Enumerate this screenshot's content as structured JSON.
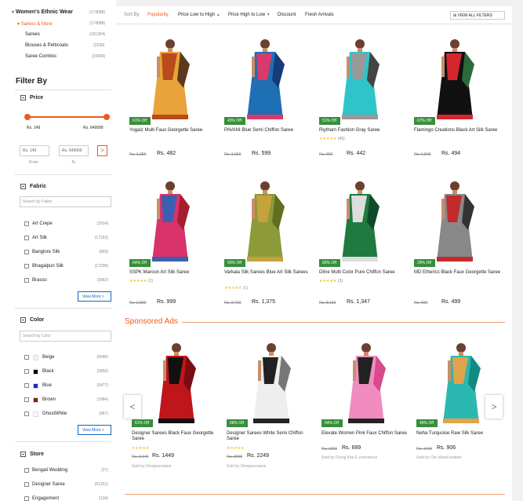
{
  "sidebar": {
    "categories": [
      {
        "label": "Women's Ethnic Wear",
        "count": "(174588)"
      },
      {
        "label": "Sarees & More",
        "count": "(174588)"
      },
      {
        "label": "Sarees",
        "count": "(161304)"
      },
      {
        "label": "Blouses & Petticoats",
        "count": "(3236)"
      },
      {
        "label": "Saree Combos",
        "count": "(10068)"
      }
    ],
    "filter_by": "Filter By",
    "price": {
      "title": "Price",
      "min_label": "Rs. 149",
      "max_label": "Rs. 649999",
      "min_input": "Rs. 149",
      "max_input": "Rs. 649999",
      "from": "From",
      "to": "To",
      "go": ">"
    },
    "fabric": {
      "title": "Fabric",
      "search_placeholder": "Search by Fabric",
      "items": [
        {
          "label": "Art Crepe",
          "count": "(2914)"
        },
        {
          "label": "Art Silk",
          "count": "(17162)"
        },
        {
          "label": "Banglore Silk",
          "count": "(803)"
        },
        {
          "label": "Bhagalpuri Silk",
          "count": "(17209)"
        },
        {
          "label": "Brasso",
          "count": "(3062)"
        }
      ],
      "view_more": "View More >"
    },
    "color": {
      "title": "Color",
      "search_placeholder": "Search by Color",
      "items": [
        {
          "label": "Beige",
          "count": "(6046)",
          "swatch": "#f5f5dc"
        },
        {
          "label": "Black",
          "count": "(5860)",
          "swatch": "#000000"
        },
        {
          "label": "Blue",
          "count": "(6477)",
          "swatch": "#1e24c9"
        },
        {
          "label": "Brown",
          "count": "(1984)",
          "swatch": "#8b1a1a"
        },
        {
          "label": "GhostWhite",
          "count": "(967)",
          "swatch": "#f8f8ff"
        }
      ],
      "view_more": "View More >"
    },
    "store": {
      "title": "Store",
      "items": [
        {
          "label": "Bengali Wedding",
          "count": "(27)"
        },
        {
          "label": "Designer Saree",
          "count": "(61251)"
        },
        {
          "label": "Engagement",
          "count": "(134)"
        }
      ]
    }
  },
  "sortbar": {
    "sort_by": "Sort By",
    "options": [
      "Popularity",
      "Price Low to High",
      "Price High to Low",
      "Discount",
      "Fresh Arrivals"
    ],
    "view_all": "VIEW ALL FILTERS"
  },
  "products": [
    {
      "badge": "61% Off",
      "title": "Yogaiz Multi Faux Georgette Saree",
      "rating": "",
      "mrp": "Rs. 1,250",
      "price": "Rs. 482"
    },
    {
      "badge": "43% Off",
      "title": "PAVANI Blue Semi Chiffon Saree",
      "rating": "",
      "mrp": "Rs. 1,050",
      "price": "Rs. 599"
    },
    {
      "badge": "51% Off",
      "title": "Riytham Fashion Gray Saree",
      "rating": "(45)",
      "mrp": "Rs. 900",
      "price": "Rs. 442"
    },
    {
      "badge": "67% Off",
      "title": "Flamingo Creations Black Art Silk Saree",
      "rating": "",
      "mrp": "Rs. 1,500",
      "price": "Rs. 494"
    },
    {
      "badge": "64% Off",
      "title": "SSPK Maroon Art Silk Saree",
      "rating": "(1)",
      "mrp": "Rs. 2,800",
      "price": "Rs. 999"
    },
    {
      "badge": "50% Off",
      "title": "Varkala Silk Sarees Blue Art Silk Sarees",
      "rating": "(1)",
      "mrp": "Rs. 2,760",
      "price": "Rs. 1,375"
    },
    {
      "badge": "83% Off",
      "title": "Dline Multi Color Pure Chiffon Saree",
      "rating": "(3)",
      "mrp": "Rs. 8,150",
      "price": "Rs. 1,347"
    },
    {
      "badge": "29% Off",
      "title": "MD Etherics Black Faux Georgette Saree",
      "rating": "",
      "mrp": "Rs. 699",
      "price": "Rs. 499"
    }
  ],
  "sponsored": {
    "title": "Sponsored Ads",
    "items": [
      {
        "badge": "61% Off",
        "title": "Designer Sarees Black Faux Georgette Saree",
        "rating": "",
        "mrp": "Rs. 3,149",
        "price": "Rs. 1449",
        "seller": "Sold by Designersaree"
      },
      {
        "badge": "68% Off",
        "title": "Designer Sarees White Semi Chiffon Saree",
        "rating": "",
        "mrp": "Rs. 2098",
        "price": "Rs. 2249",
        "seller": "Sold by Designersaree"
      },
      {
        "badge": "64% Off",
        "title": "Elevate Women Pink Faux Chiffon Saree",
        "rating": "",
        "mrp": "Rs. 1900",
        "price": "Rs. 689",
        "seller": "Sold by Flying Kite E-commerce"
      },
      {
        "badge": "40% Off",
        "title": "Neha Turquoise Raw Silk Saree",
        "rating": "",
        "mrp": "Rs. 1499",
        "price": "Rs. 906",
        "seller": "Sold by Om shanti textiles"
      }
    ],
    "prev": "<",
    "next": ">"
  }
}
